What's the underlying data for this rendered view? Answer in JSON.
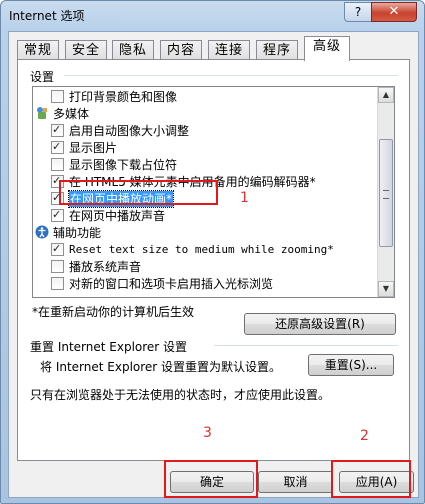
{
  "window": {
    "title": "Internet 选项",
    "help_glyph": "?",
    "close_glyph": "✕"
  },
  "tabs": [
    "常规",
    "安全",
    "隐私",
    "内容",
    "连接",
    "程序",
    "高级"
  ],
  "settings_group": {
    "label": "设置",
    "items": [
      {
        "type": "check",
        "checked": false,
        "text": "打印背景颜色和图像"
      },
      {
        "type": "category",
        "icon": "multimedia-icon",
        "text": "多媒体"
      },
      {
        "type": "check",
        "checked": true,
        "text": "启用自动图像大小调整"
      },
      {
        "type": "check",
        "checked": true,
        "text": "显示图片"
      },
      {
        "type": "check",
        "checked": false,
        "text": "显示图像下载占位符"
      },
      {
        "type": "check",
        "checked": true,
        "text": "在 HTML5 媒体元素中启用备用的编码解码器*"
      },
      {
        "type": "check",
        "checked": true,
        "text": "在网页中播放动画*",
        "selected": true
      },
      {
        "type": "check",
        "checked": true,
        "text": "在网页中播放声音"
      },
      {
        "type": "category",
        "icon": "accessibility-icon",
        "text": "辅助功能"
      },
      {
        "type": "check",
        "checked": true,
        "text": "Reset text size to medium while zooming*"
      },
      {
        "type": "check",
        "checked": false,
        "text": "播放系统声音"
      },
      {
        "type": "check",
        "checked": false,
        "text": "对新的窗口和选项卡启用插入光标浏览"
      }
    ]
  },
  "restart_note": "*在重新启动你的计算机后生效",
  "restore_advanced_button": "还原高级设置(R)",
  "reset_group": {
    "label": "重置 Internet Explorer 设置",
    "description": "将 Internet Explorer 设置重置为默认设置。",
    "reset_button": "重置(S)...",
    "note": "只有在浏览器处于无法使用的状态时，才应使用此设置。"
  },
  "footer": {
    "ok": "确定",
    "cancel": "取消",
    "apply": "应用(A)"
  },
  "annotations": {
    "n1": "1",
    "n2": "2",
    "n3": "3"
  },
  "colors": {
    "annotation_red": "#e01a1a",
    "selection_blue": "#3399ff"
  }
}
